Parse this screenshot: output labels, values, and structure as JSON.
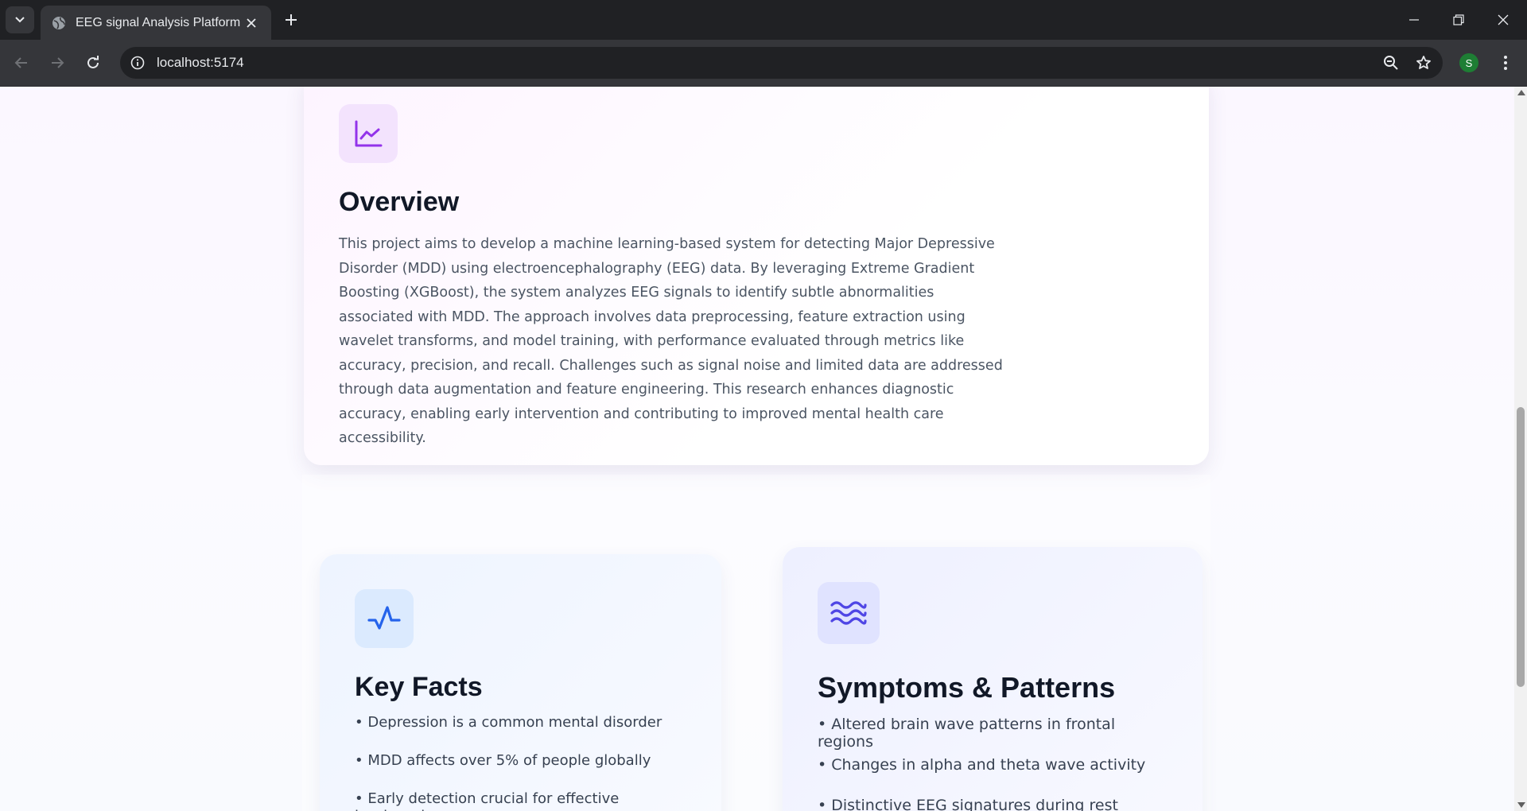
{
  "browser": {
    "tab_title": "EEG signal Analysis Platform",
    "url": "localhost:5174",
    "profile_initial": "S"
  },
  "overview": {
    "icon": "line-chart-icon",
    "title": "Overview",
    "text": "This project aims to develop a machine learning-based system for detecting Major Depressive Disorder (MDD) using electroencephalography (EEG) data. By leveraging Extreme Gradient Boosting (XGBoost), the system analyzes EEG signals to identify subtle abnormalities associated with MDD. The approach involves data preprocessing, feature extraction using wavelet transforms, and model training, with performance evaluated through metrics like accuracy, precision, and recall. Challenges such as signal noise and limited data are addressed through data augmentation and feature engineering. This research enhances diagnostic accuracy, enabling early intervention and contributing to improved mental health care accessibility."
  },
  "key_facts": {
    "icon": "activity-icon",
    "title": "Key Facts",
    "items": [
      "• Depression is a common mental disorder",
      "• MDD affects over 5% of people globally",
      "• Early detection crucial for effective treatment"
    ]
  },
  "symptoms": {
    "icon": "waves-icon",
    "title": "Symptoms & Patterns",
    "items": [
      "• Altered brain wave patterns in frontal regions",
      "• Changes in alpha and theta wave activity",
      "• Distinctive EEG signatures during rest states"
    ]
  },
  "colors": {
    "overview_icon": "#9333ea",
    "key_facts_icon": "#2563eb",
    "symptoms_icon": "#4f46e5"
  }
}
